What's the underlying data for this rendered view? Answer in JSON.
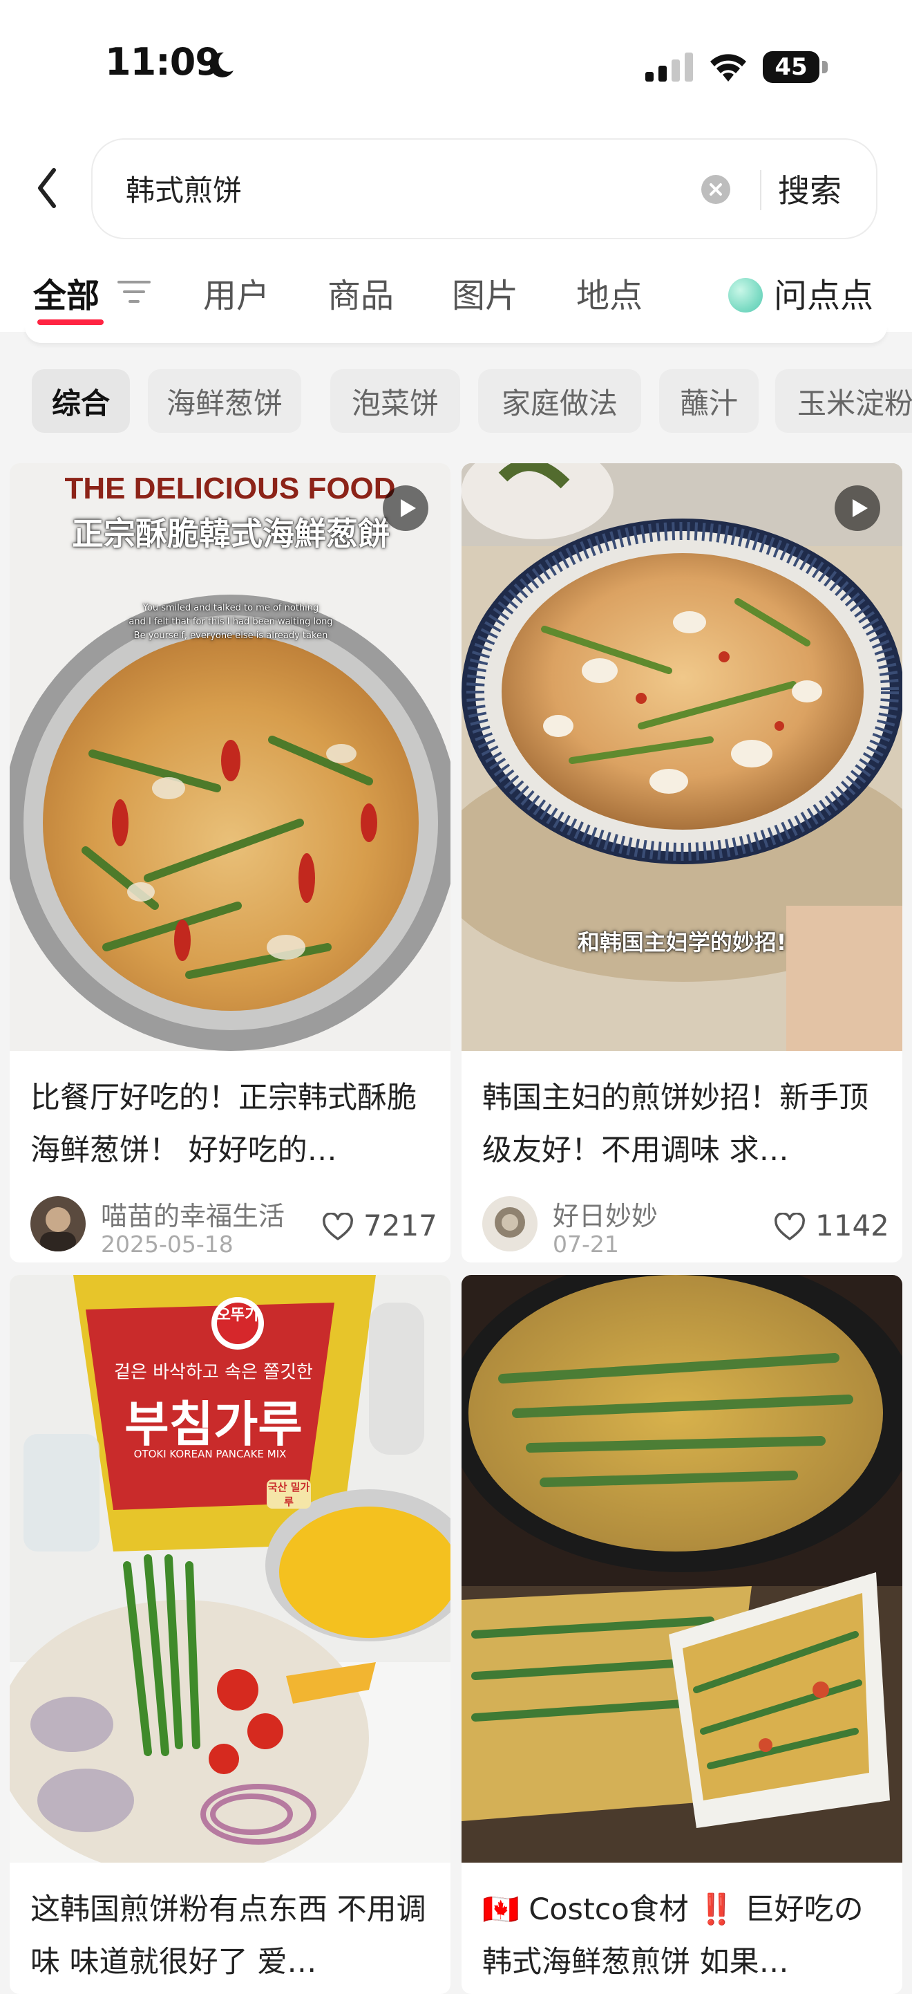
{
  "status_bar": {
    "time": "11:09",
    "battery": "45",
    "battery_level": 0.45
  },
  "search": {
    "query": "韩式煎饼",
    "button_label": "搜索"
  },
  "tabs": [
    {
      "label": "全部"
    },
    {
      "label": "用户"
    },
    {
      "label": "商品"
    },
    {
      "label": "图片"
    },
    {
      "label": "地点"
    }
  ],
  "ask": {
    "label": "问点点"
  },
  "chips": [
    "综合",
    "海鲜葱饼",
    "泡菜饼",
    "家庭做法",
    "蘸汁",
    "玉米淀粉"
  ],
  "posts": [
    {
      "title": "比餐厅好吃的！正宗韩式酥脆海鲜葱饼！ 好好吃的…",
      "author": "喵苗的幸福生活",
      "date": "2025-05-18",
      "likes": "7217",
      "overlay_heading": "THE DELICIOUS FOOD",
      "overlay_subheading": "正宗酥脆韓式海鮮葱餅",
      "overlay_lines": [
        "You smiled and talked to me of nothing",
        "and I felt that for this I had been waiting long",
        "Be yourself, everyone else is already taken"
      ]
    },
    {
      "title": "韩国主妇的煎饼妙招！新手顶级友好！不用调味 求…",
      "author": "好日妙妙",
      "date": "07-21",
      "likes": "1142",
      "overlay_caption": "和韩国主妇学的妙招!"
    },
    {
      "title": "这韩国煎饼粉有点东西 不用调味 味道就很好了 爱…",
      "package_brand": "오뚜기",
      "package_text": "부침가루",
      "package_korean": "겉은 바삭하고 속은 쫄깃한",
      "package_subtitle": "OTOKI KOREAN PANCAKE MIX",
      "package_badge": "국산 밀가루"
    },
    {
      "title": "🇨🇦 Costco食材 ‼️ 巨好吃の韩式海鲜葱煎饼 如果…"
    }
  ],
  "colors": {
    "accent": "#ff2442",
    "chip_bg": "#ececec",
    "page_bg": "#f4f4f4"
  }
}
